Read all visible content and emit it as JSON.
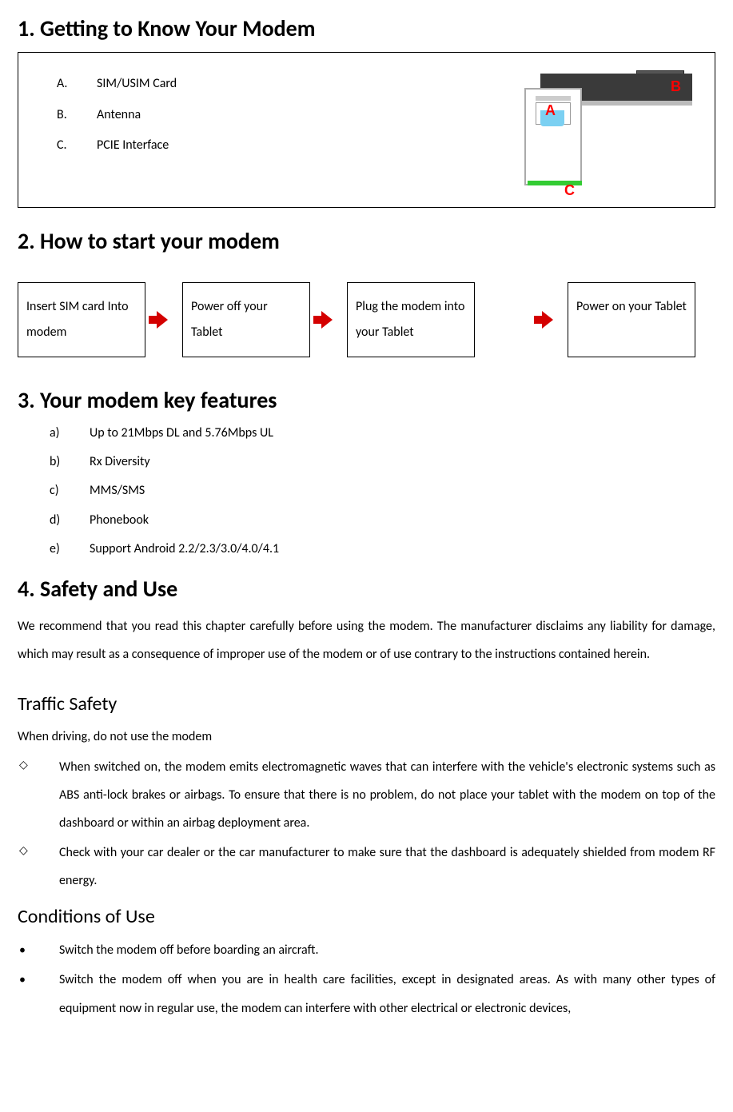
{
  "section1": {
    "heading": "1.  Getting to Know Your Modem",
    "items": [
      {
        "letter": "A.",
        "text": "SIM/USIM Card"
      },
      {
        "letter": "B.",
        "text": "Antenna"
      },
      {
        "letter": "C.",
        "text": "PCIE Interface"
      }
    ],
    "diagram_labels": {
      "a": "A",
      "b": "B",
      "c": "C"
    }
  },
  "section2": {
    "heading": "2. How to start your modem",
    "steps": [
      "Insert SIM card Into modem",
      "Power off your Tablet",
      "Plug the modem into your Tablet",
      "Power on your Tablet"
    ]
  },
  "section3": {
    "heading": "3.  Your modem key features",
    "items": [
      {
        "letter": "a)",
        "text": "Up to 21Mbps DL and 5.76Mbps UL"
      },
      {
        "letter": "b)",
        "text": "Rx Diversity"
      },
      {
        "letter": "c)",
        "text": "MMS/SMS"
      },
      {
        "letter": "d)",
        "text": "Phonebook"
      },
      {
        "letter": "e)",
        "text": "Support Android 2.2/2.3/3.0/4.0/4.1"
      }
    ]
  },
  "section4": {
    "heading": "4. Safety and Use",
    "intro": "We recommend that you read this chapter carefully before using the modem. The manufacturer disclaims any liability for damage, which may result as a consequence of improper use of the modem or of use contrary to the instructions contained herein.",
    "traffic_heading": "Traffic Safety",
    "traffic_intro": "When driving, do not use the modem",
    "traffic_items": [
      "When switched on, the modem emits electromagnetic waves that can interfere with the vehicle's electronic systems such as ABS anti-lock brakes or airbags. To ensure that there is no problem, do not place your tablet with the modem on top of the dashboard or within an airbag deployment area.",
      "Check with your car dealer or the car manufacturer to make sure that the dashboard is adequately shielded from modem RF energy."
    ],
    "conditions_heading": "Conditions of Use",
    "conditions_items": [
      "Switch the modem off before boarding an aircraft.",
      "Switch the modem off when you are in health care facilities, except in designated areas. As with many other types of equipment now in regular use, the modem can interfere with other electrical or electronic devices,"
    ]
  }
}
